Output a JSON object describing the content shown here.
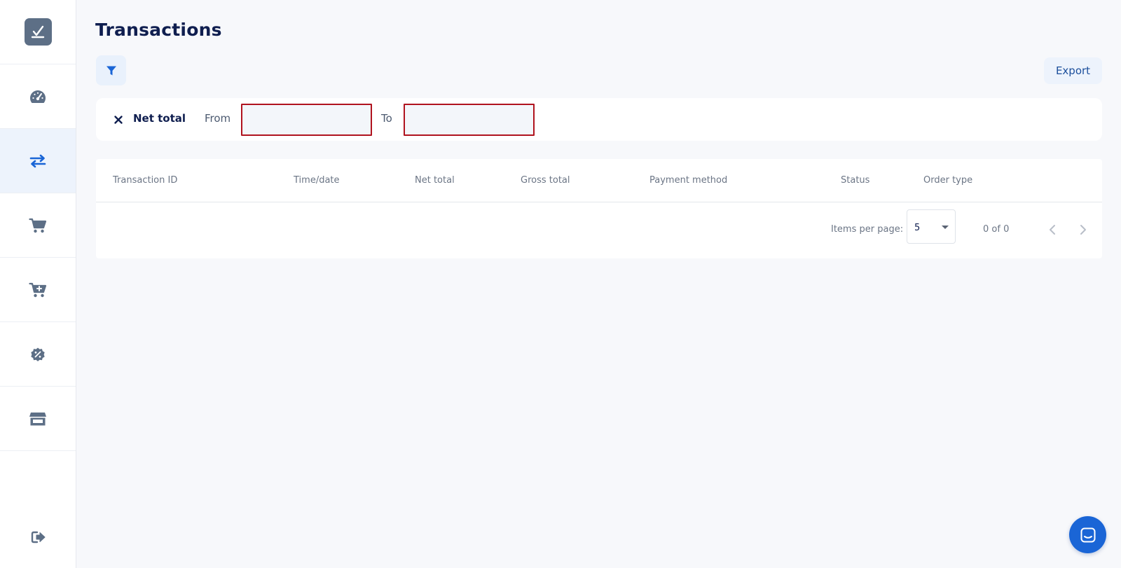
{
  "page": {
    "title": "Transactions"
  },
  "toolbar": {
    "export_label": "Export"
  },
  "filter": {
    "chip_label": "Net total",
    "from_label": "From",
    "to_label": "To",
    "from_value": "",
    "to_value": ""
  },
  "table": {
    "columns": [
      "Transaction ID",
      "Time/date",
      "Net total",
      "Gross total",
      "Payment method",
      "Status",
      "Order type"
    ],
    "rows": []
  },
  "paginator": {
    "items_per_page_label": "Items per page:",
    "items_per_page_value": "5",
    "range_label": "0 of 0"
  },
  "colors": {
    "accent": "#1a65d6",
    "title": "#0f1e4f",
    "error_border": "#b0131e",
    "active_nav_bg": "#edf3fc"
  },
  "sidebar": {
    "items": [
      {
        "icon": "dashboard-gauge-icon"
      },
      {
        "icon": "transactions-arrows-icon",
        "active": true
      },
      {
        "icon": "cart-icon"
      },
      {
        "icon": "cart-add-icon"
      },
      {
        "icon": "discount-badge-icon"
      },
      {
        "icon": "store-icon"
      }
    ],
    "logout_icon": "logout-icon"
  }
}
